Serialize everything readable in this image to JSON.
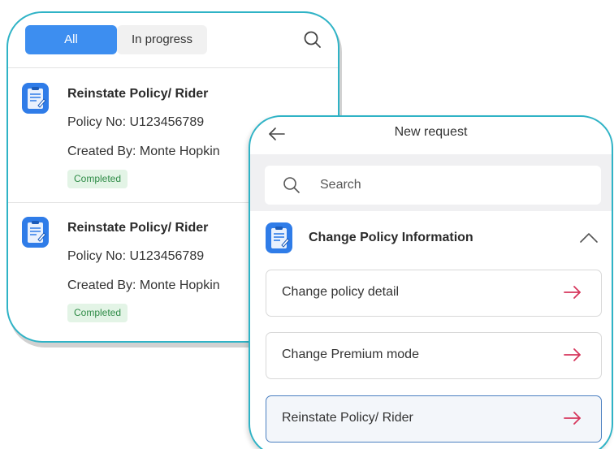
{
  "request_list": {
    "tabs": [
      {
        "label": "All",
        "active": true
      },
      {
        "label": "In progress",
        "active": false
      }
    ],
    "items": [
      {
        "title": "Reinstate Policy/ Rider",
        "policy_no": "Policy No: U123456789",
        "created_by": "Created By: Monte Hopkin",
        "status": "Completed"
      },
      {
        "title": "Reinstate Policy/ Rider",
        "policy_no": "Policy No: U123456789",
        "created_by": "Created By: Monte Hopkin",
        "status": "Completed"
      }
    ]
  },
  "new_request": {
    "title": "New request",
    "search": {
      "placeholder": "Search"
    },
    "section": {
      "title": "Change Policy Information",
      "expanded": true,
      "options": [
        {
          "label": "Change policy detail",
          "selected": false
        },
        {
          "label": "Change Premium mode",
          "selected": false
        },
        {
          "label": "Reinstate Policy/ Rider",
          "selected": true
        }
      ]
    }
  },
  "colors": {
    "accent": "#3d8ef0",
    "card_border": "#2fb3c6",
    "arrow": "#d6365c",
    "status_bg": "#e3f4e6",
    "status_text": "#2e8b46"
  },
  "icons": {
    "search": "search-icon",
    "back": "arrow-left-icon",
    "document": "document-icon",
    "collapse": "chevron-up-icon",
    "go": "arrow-right-icon"
  }
}
